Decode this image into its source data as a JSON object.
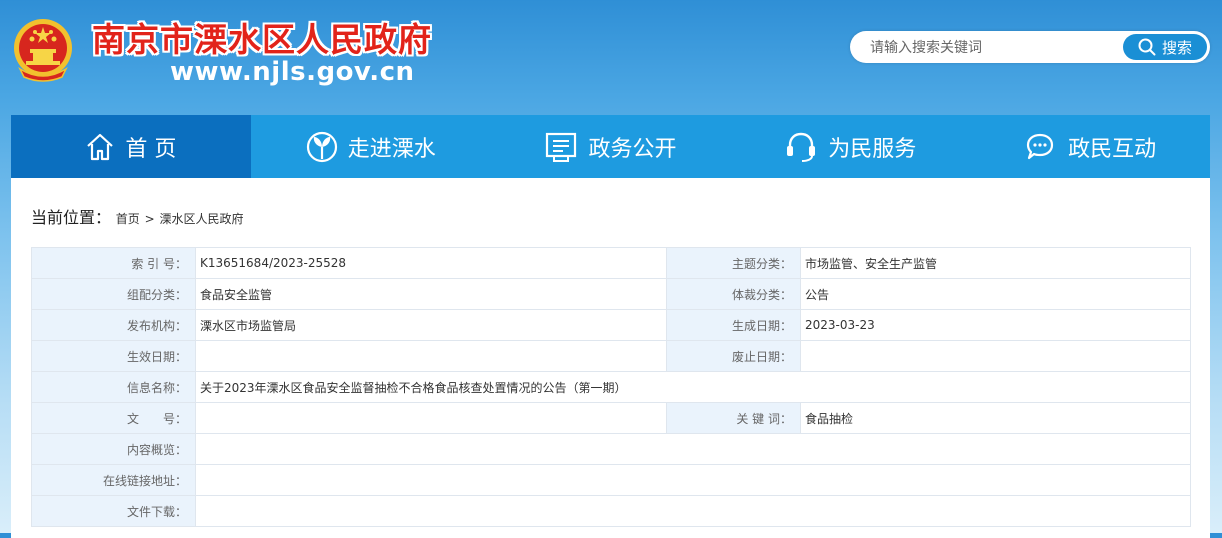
{
  "header": {
    "site_title": "南京市溧水区人民政府",
    "site_url": "www.njls.gov.cn",
    "search_placeholder": "请输入搜索关键词",
    "search_button": "搜索"
  },
  "nav": [
    {
      "label": "首 页",
      "icon": "home-icon"
    },
    {
      "label": "走进溧水",
      "icon": "leaf-icon"
    },
    {
      "label": "政务公开",
      "icon": "document-icon"
    },
    {
      "label": "为民服务",
      "icon": "headset-icon"
    },
    {
      "label": "政民互动",
      "icon": "chat-icon"
    }
  ],
  "breadcrumb": {
    "label": "当前位置：",
    "home": "首页",
    "separator": ">",
    "current": "溧水区人民政府"
  },
  "meta": {
    "index_label": "索 引 号：",
    "index_value": "K13651684/2023-25528",
    "topic_label": "主题分类：",
    "topic_value": "市场监管、安全生产监管",
    "config_label": "组配分类：",
    "config_value": "食品安全监管",
    "genre_label": "体裁分类：",
    "genre_value": "公告",
    "publisher_label": "发布机构：",
    "publisher_value": "溧水区市场监管局",
    "created_label": "生成日期：",
    "created_value": "2023-03-23",
    "effective_label": "生效日期：",
    "effective_value": "",
    "abolished_label": "废止日期：",
    "abolished_value": "",
    "name_label": "信息名称：",
    "name_value": "关于2023年溧水区食品安全监督抽检不合格食品核查处置情况的公告（第一期）",
    "docno_label": "文　　号：",
    "docno_value": "",
    "keywords_label": "关 键 词：",
    "keywords_value": "食品抽检",
    "summary_label": "内容概览：",
    "summary_value": "",
    "link_label": "在线链接地址：",
    "link_value": "",
    "download_label": "文件下载：",
    "download_value": ""
  },
  "colors": {
    "nav_bg": "#1e9be0",
    "nav_active": "#0b6fbf",
    "title_red": "#e2231a",
    "label_bg": "#eaf3fc"
  }
}
